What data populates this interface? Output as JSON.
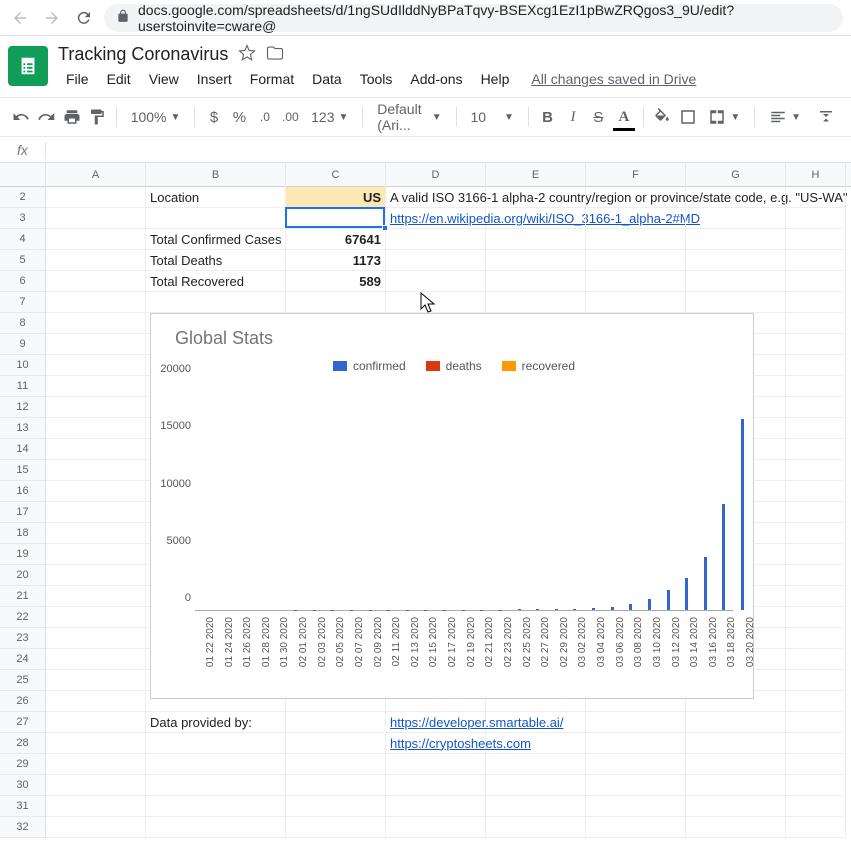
{
  "browser": {
    "url": "docs.google.com/spreadsheets/d/1ngSUdIlddNyBPaTqvy-BSEXcg1EzI1pBwZRQgos3_9U/edit?userstoinvite=cware@"
  },
  "doc": {
    "title": "Tracking Coronavirus",
    "save_status": "All changes saved in Drive"
  },
  "menus": [
    "File",
    "Edit",
    "View",
    "Insert",
    "Format",
    "Data",
    "Tools",
    "Add-ons",
    "Help"
  ],
  "toolbar": {
    "zoom": "100%",
    "font": "Default (Ari...",
    "font_size": "10",
    "number_format": "123"
  },
  "columns": [
    "A",
    "B",
    "C",
    "D",
    "E",
    "F",
    "G",
    "H"
  ],
  "rows": [
    "2",
    "3",
    "4",
    "5",
    "6",
    "7",
    "8",
    "9",
    "10",
    "11",
    "12",
    "13",
    "14",
    "15",
    "16",
    "17",
    "18",
    "19",
    "20",
    "21",
    "22",
    "23",
    "24",
    "25",
    "26",
    "27",
    "28",
    "29",
    "30",
    "31",
    "32"
  ],
  "cells": {
    "b2": "Location",
    "c2": "US",
    "d2": "A valid ISO 3166-1 alpha-2 country/region or province/state code, e.g. \"US-WA\"",
    "d3": "https://en.wikipedia.org/wiki/ISO_3166-1_alpha-2#MD",
    "b4": "Total Confirmed Cases",
    "c4": "67641",
    "b5": "Total Deaths",
    "c5": "1173",
    "b6": "Total Recovered",
    "c6": "589",
    "b27": "Data provided by:",
    "d27": "https://developer.smartable.ai/",
    "d28": "https://cryptosheets.com"
  },
  "chart_data": {
    "type": "bar",
    "title": "Global Stats",
    "legend": [
      "confirmed",
      "deaths",
      "recovered"
    ],
    "legend_colors": [
      "#3366cc",
      "#dc3912",
      "#ff9900"
    ],
    "ylabel": "",
    "xlabel": "",
    "ylim": [
      0,
      20000
    ],
    "y_ticks": [
      0,
      5000,
      10000,
      15000,
      20000
    ],
    "categories": [
      "01 22 2020",
      "01 24 2020",
      "01 26 2020",
      "01 28 2020",
      "01 30 2020",
      "02 01 2020",
      "02 03 2020",
      "02 05 2020",
      "02 07 2020",
      "02 09 2020",
      "02 11 2020",
      "02 13 2020",
      "02 15 2020",
      "02 17 2020",
      "02 19 2020",
      "02 21 2020",
      "02 23 2020",
      "02 25 2020",
      "02 27 2020",
      "02 29 2020",
      "03 02 2020",
      "03 04 2020",
      "03 06 2020",
      "03 08 2020",
      "03 10 2020",
      "03 12 2020",
      "03 14 2020",
      "03 16 2020",
      "03 18 2020",
      "03 20 2020"
    ],
    "series": [
      {
        "name": "confirmed",
        "values": [
          1,
          2,
          5,
          5,
          6,
          8,
          11,
          12,
          12,
          12,
          13,
          15,
          15,
          15,
          15,
          35,
          35,
          53,
          60,
          70,
          100,
          160,
          280,
          540,
          980,
          1700,
          2800,
          4600,
          9200,
          16600
        ]
      }
    ]
  }
}
